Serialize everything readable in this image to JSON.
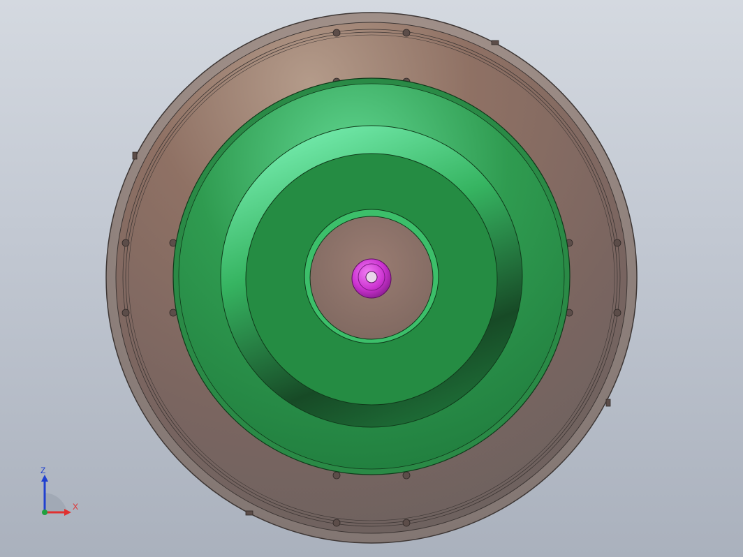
{
  "viewport": {
    "background_top": "#d4d9e0",
    "background_bottom": "#aab1bd"
  },
  "model": {
    "housing_color": "#8a7164",
    "rim_color": "#9a8a82",
    "green_part_color": "#2f9a4f",
    "green_highlight": "#7ef0b2",
    "center_plate_color": "#8a6f66",
    "hub_color": "#d13fd6",
    "bolt_icon": "bolt-head-icon"
  },
  "triad": {
    "x_label": "X",
    "z_label": "Z",
    "x_color": "#e03030",
    "z_color": "#2040d0",
    "y_color": "#20a040"
  }
}
